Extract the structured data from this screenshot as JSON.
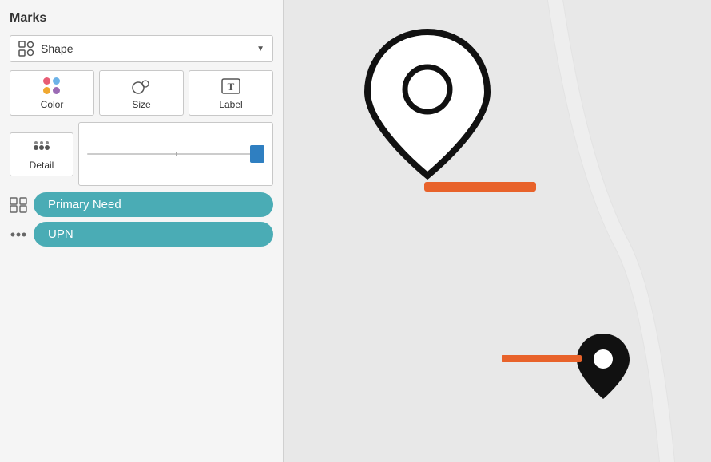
{
  "panel": {
    "title": "Marks",
    "shape_dropdown": {
      "label": "Shape",
      "icon": "shape-icon"
    },
    "buttons": [
      {
        "id": "color",
        "label": "Color"
      },
      {
        "id": "size",
        "label": "Size"
      },
      {
        "id": "label",
        "label": "Label"
      }
    ],
    "detail": {
      "label": "Detail"
    },
    "chips": [
      {
        "id": "primary-need",
        "label": "Primary Need",
        "icon": "shape-chip-icon"
      },
      {
        "id": "upn",
        "label": "UPN",
        "icon": "detail-chip-icon"
      }
    ]
  },
  "colors": {
    "dot1": "#e85d75",
    "dot2": "#6db3e8",
    "dot3": "#f0a830",
    "dot4": "#9b6bb5",
    "chip_bg": "#4aacb5",
    "slider_thumb": "#2f7fc1",
    "orange_bar": "#e8622a"
  }
}
